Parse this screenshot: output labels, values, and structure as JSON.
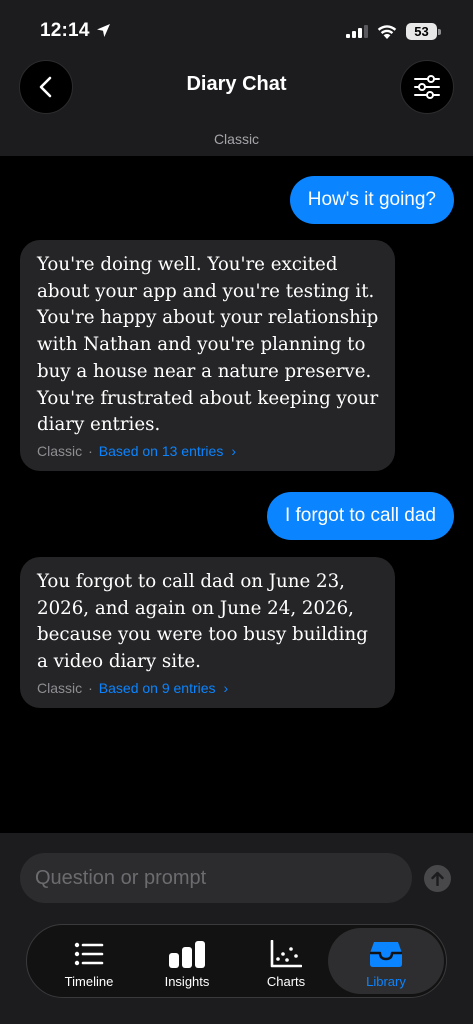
{
  "status_bar": {
    "time": "12:14",
    "battery": "53"
  },
  "header": {
    "title": "Diary Chat",
    "subtitle": "Classic"
  },
  "messages": [
    {
      "role": "user",
      "text": "How's it going?"
    },
    {
      "role": "assistant",
      "text": "You're doing well. You're excited about your app and you're testing it. You're happy about your relationship with Nathan and you're planning to buy a house near a nature preserve. You're frustrated about keeping your diary entries.",
      "mode": "Classic",
      "source": "Based on 13 entries"
    },
    {
      "role": "user",
      "text": "I forgot to call dad"
    },
    {
      "role": "assistant",
      "text": "You forgot to call dad on June 23, 2026, and again on June 24, 2026, because you were too busy building a video diary site.",
      "mode": "Classic",
      "source": "Based on 9 entries"
    }
  ],
  "composer": {
    "placeholder": "Question or prompt",
    "value": ""
  },
  "tabs": [
    {
      "label": "Timeline",
      "icon": "list-icon",
      "active": false
    },
    {
      "label": "Insights",
      "icon": "bar-chart-icon",
      "active": false
    },
    {
      "label": "Charts",
      "icon": "scatter-chart-icon",
      "active": false
    },
    {
      "label": "Library",
      "icon": "inbox-tray-icon",
      "active": true
    }
  ],
  "colors": {
    "accent": "#0a84ff",
    "background": "#000000",
    "surface": "#1c1c1e",
    "bubble": "#252527"
  }
}
